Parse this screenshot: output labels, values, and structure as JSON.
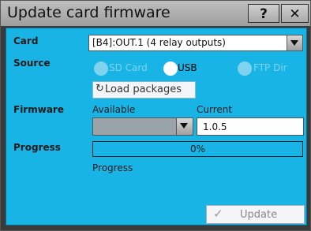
{
  "window": {
    "title": "Update card firmware",
    "help_label": "?",
    "close_label": "✕"
  },
  "card": {
    "label": "Card",
    "selected": "[B4]:OUT.1 (4 relay outputs)"
  },
  "source": {
    "label": "Source",
    "options": [
      {
        "label": "SD Card",
        "enabled": false
      },
      {
        "label": "USB",
        "enabled": true
      },
      {
        "label": "FTP Dir",
        "enabled": false
      }
    ],
    "load_button": "Load packages"
  },
  "firmware": {
    "label": "Firmware",
    "available_label": "Available",
    "current_label": "Current",
    "available_value": "",
    "current_value": "1.0.5"
  },
  "progress": {
    "label": "Progress",
    "percent_text": "0%",
    "percent": 0,
    "status_text": "Progress"
  },
  "actions": {
    "update_label": "Update"
  },
  "colors": {
    "panel": "#19b4e6",
    "titlebar": "#b0b0b0",
    "frame": "#3a3a3a"
  }
}
